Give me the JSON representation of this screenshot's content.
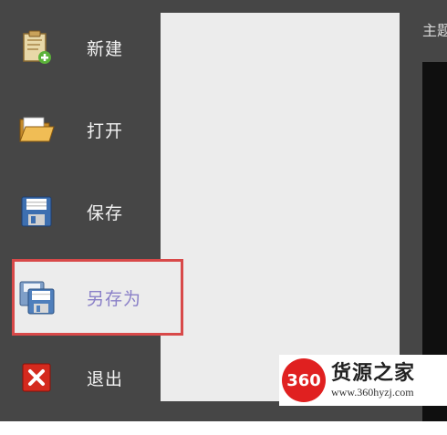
{
  "menu": {
    "items": [
      {
        "label": "新建",
        "icon": "new-document-icon"
      },
      {
        "label": "打开",
        "icon": "open-folder-icon"
      },
      {
        "label": "保存",
        "icon": "save-disk-icon"
      },
      {
        "label": "另存为",
        "icon": "save-as-icon",
        "selected": true
      },
      {
        "label": "退出",
        "icon": "exit-icon"
      }
    ]
  },
  "corner_text": "主题",
  "watermark": {
    "logo_text": "360",
    "title": "货源之家",
    "url": "www.360hyzj.com"
  },
  "colors": {
    "menu_bg": "#464646",
    "panel_bg": "#ececec",
    "highlight_border": "#d84949",
    "selected_label": "#8a80c8"
  }
}
